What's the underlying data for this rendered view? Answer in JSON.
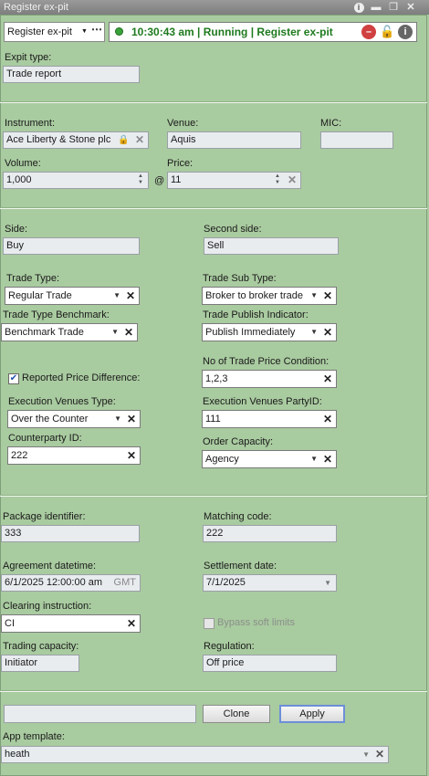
{
  "window": {
    "title": "Register ex-pit"
  },
  "toolbar": {
    "app_select": "Register ex-pit",
    "status": "10:30:43 am | Running | Register ex-pit",
    "status_color": "#1e7a1e"
  },
  "expit": {
    "label": "Expit type:",
    "value": "Trade report"
  },
  "instrument": {
    "label": "Instrument:",
    "value": "Ace Liberty & Stone plc"
  },
  "venue": {
    "label": "Venue:",
    "value": "Aquis"
  },
  "mic": {
    "label": "MIC:",
    "value": ""
  },
  "volume": {
    "label": "Volume:",
    "value": "1,000"
  },
  "at_symbol": "@",
  "price": {
    "label": "Price:",
    "value": "11"
  },
  "side": {
    "label": "Side:",
    "value": "Buy"
  },
  "second_side": {
    "label": "Second side:",
    "value": "Sell"
  },
  "trade_type": {
    "label": "Trade Type:",
    "value": "Regular Trade"
  },
  "trade_sub_type": {
    "label": "Trade Sub Type:",
    "value": "Broker to broker trade"
  },
  "trade_type_benchmark": {
    "label": "Trade Type Benchmark:",
    "value": "Benchmark Trade"
  },
  "trade_publish_indicator": {
    "label": "Trade Publish Indicator:",
    "value": "Publish Immediately"
  },
  "trade_price_condition": {
    "label": "No of Trade Price Condition:",
    "value": "1,2,3"
  },
  "reported_price_difference": {
    "label": "Reported Price Difference:",
    "checked": true
  },
  "execution_venues_type": {
    "label": "Execution Venues Type:",
    "value": "Over the Counter"
  },
  "execution_venues_party_id": {
    "label": "Execution Venues PartyID:",
    "value": "111"
  },
  "counterparty_id": {
    "label": "Counterparty ID:",
    "value": "222"
  },
  "order_capacity": {
    "label": "Order Capacity:",
    "value": "Agency"
  },
  "package_identifier": {
    "label": "Package identifier:",
    "value": "333"
  },
  "matching_code": {
    "label": "Matching code:",
    "value": "222"
  },
  "agreement_datetime": {
    "label": "Agreement datetime:",
    "value": "6/1/2025 12:00:00 am",
    "tz": "GMT"
  },
  "settlement_date": {
    "label": "Settlement date:",
    "value": "7/1/2025"
  },
  "clearing_instruction": {
    "label": "Clearing instruction:",
    "value": "CI"
  },
  "bypass_soft_limits": {
    "label": "Bypass soft limits",
    "checked": false
  },
  "trading_capacity": {
    "label": "Trading capacity:",
    "value": "Initiator"
  },
  "regulation": {
    "label": "Regulation:",
    "value": "Off price"
  },
  "footer": {
    "note_value": "",
    "clone_label": "Clone",
    "apply_label": "Apply"
  },
  "app_template": {
    "label": "App template:",
    "value": "heath"
  },
  "icons": {
    "info": "info-icon",
    "minimize": "minimize-icon",
    "restore": "restore-icon",
    "close": "close-icon",
    "stop": "stop-icon",
    "lock": "lock-icon",
    "clear": "clear-x-icon",
    "dropdown": "chevron-down-icon"
  }
}
